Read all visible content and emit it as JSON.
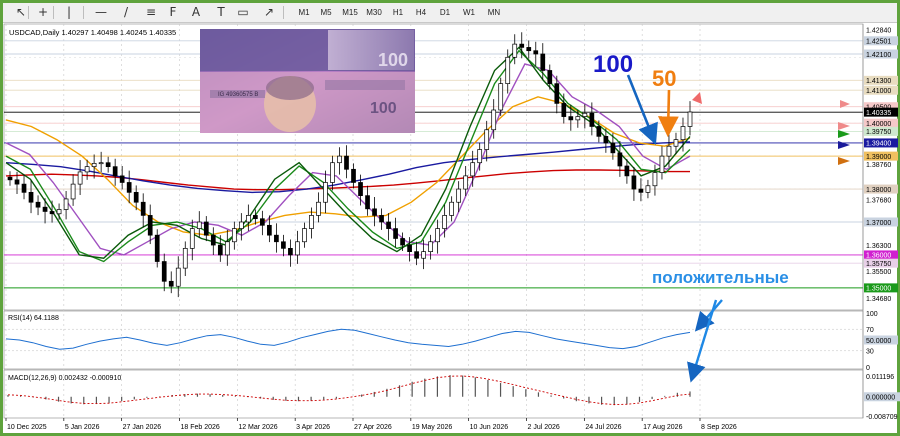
{
  "toolbar": {
    "tools": [
      "cursor-icon",
      "crosshair-icon",
      "vertical-line-icon",
      "horizontal-line-icon",
      "trendline-icon",
      "equidistant-channel-icon",
      "fibonacci-icon",
      "text-icon",
      "label-icon",
      "rectangle-icon",
      "arrow-tool-icon"
    ],
    "timeframes": [
      "M1",
      "M5",
      "M15",
      "M30",
      "H1",
      "H4",
      "D1",
      "W1",
      "MN"
    ]
  },
  "header": {
    "symbol_line": "USDCAD,Daily  1.40297 1.40498 1.40245 1.40335"
  },
  "annotations": {
    "label_100": "100",
    "label_50": "50",
    "label_positive": "положительные"
  },
  "colors": {
    "background": "#ffffff",
    "grid": "#b0b0b0",
    "candle": "#000000",
    "ma_red": "#cc0000",
    "ma_blue": "#1a1aa0",
    "ma_orange": "#f0a000",
    "ma_purple": "#a050c0",
    "ma_green": "#1a8a1a",
    "ma_darkgreen": "#0a5a0a",
    "rsi_line": "#1e6fd0",
    "arrow_blue": "#1565c0",
    "arrow_orange": "#f07e10",
    "frame_green": "#5fa33d"
  },
  "chart_data": [
    {
      "type": "line",
      "title": "USDCAD,Daily",
      "x_labels": [
        "10 Dec 2025",
        "5 Jan 2026",
        "27 Jan 2026",
        "18 Feb 2026",
        "12 Mar 2026",
        "3 Apr 2026",
        "27 Apr 2026",
        "19 May 2026",
        "10 Jun 2026",
        "2 Jul 2026",
        "24 Jul 2026",
        "17 Aug 2026",
        "8 Sep 2026"
      ],
      "y_ticks": [
        "1.42840",
        "1.42501",
        "1.42100",
        "1.41300",
        "1.41000",
        "1.40500",
        "1.40335",
        "1.40000",
        "1.39750",
        "1.39400",
        "1.39000",
        "1.38760",
        "1.38000",
        "1.37680",
        "1.37000",
        "1.36300",
        "1.36000",
        "1.35750",
        "1.35500",
        "1.35000",
        "1.34680"
      ],
      "highlighted_levels": [
        {
          "value": 1.42501,
          "label": "1.42501",
          "color": "#c9d3e0"
        },
        {
          "value": 1.421,
          "label": "1.42100",
          "color": "#c9d3e0"
        },
        {
          "value": 1.413,
          "label": "1.41300",
          "color": "#e8dcc0"
        },
        {
          "value": 1.41,
          "label": "1.41000",
          "color": "#e8dcc0"
        },
        {
          "value": 1.405,
          "label": "1.40500",
          "color": "#f6c9c9"
        },
        {
          "value": 1.40335,
          "label": "1.40335",
          "color": "#000000"
        },
        {
          "value": 1.4,
          "label": "1.40000",
          "color": "#f6c9c9"
        },
        {
          "value": 1.3975,
          "label": "1.39750",
          "color": "#cfe8cf"
        },
        {
          "value": 1.394,
          "label": "1.39400",
          "color": "#1a1aa0"
        },
        {
          "value": 1.39,
          "label": "1.39000",
          "color": "#f0c060"
        },
        {
          "value": 1.38,
          "label": "1.38000",
          "color": "#e0d0c0"
        },
        {
          "value": 1.37,
          "label": "1.37000",
          "color": "#c9d3e0"
        },
        {
          "value": 1.36,
          "label": "1.36000",
          "color": "#d020d0"
        },
        {
          "value": 1.3575,
          "label": "1.35750",
          "color": "#e8d0e8"
        },
        {
          "value": 1.35,
          "label": "1.35000",
          "color": "#1a9a1a"
        }
      ],
      "ylim": [
        1.3445,
        1.4295
      ],
      "close": [
        1.3828,
        1.3815,
        1.379,
        1.376,
        1.3745,
        1.3732,
        1.3725,
        1.3738,
        1.377,
        1.3815,
        1.3852,
        1.3868,
        1.3878,
        1.388,
        1.3868,
        1.384,
        1.382,
        1.379,
        1.376,
        1.372,
        1.366,
        1.358,
        1.352,
        1.3505,
        1.356,
        1.362,
        1.368,
        1.37,
        1.366,
        1.363,
        1.36,
        1.364,
        1.368,
        1.37,
        1.372,
        1.371,
        1.369,
        1.366,
        1.364,
        1.362,
        1.36,
        1.364,
        1.368,
        1.372,
        1.376,
        1.382,
        1.388,
        1.39,
        1.386,
        1.382,
        1.378,
        1.374,
        1.372,
        1.37,
        1.368,
        1.365,
        1.363,
        1.361,
        1.359,
        1.361,
        1.364,
        1.368,
        1.372,
        1.376,
        1.38,
        1.384,
        1.388,
        1.392,
        1.398,
        1.404,
        1.412,
        1.42,
        1.424,
        1.423,
        1.422,
        1.421,
        1.416,
        1.412,
        1.406,
        1.402,
        1.401,
        1.402,
        1.403,
        1.399,
        1.396,
        1.394,
        1.391,
        1.387,
        1.384,
        1.38,
        1.379,
        1.381,
        1.385,
        1.39,
        1.393,
        1.395,
        1.399,
        1.4034
      ],
      "series": [
        {
          "color": "#cc0000",
          "values": [
            1.384,
            1.3843,
            1.3845,
            1.3843,
            1.384,
            1.3835,
            1.3828,
            1.382,
            1.3812,
            1.3806,
            1.38,
            1.3798,
            1.3798,
            1.38,
            1.3802,
            1.3805,
            1.3808,
            1.3812,
            1.3818,
            1.3825,
            1.3833,
            1.384,
            1.3847,
            1.3852,
            1.3856,
            1.3858,
            1.3858,
            1.3857,
            1.3855,
            1.3853,
            1.3853
          ]
        },
        {
          "color": "#1a1aa0",
          "values": [
            1.388,
            1.3875,
            1.3868,
            1.3855,
            1.384,
            1.3825,
            1.3812,
            1.3802,
            1.3795,
            1.379,
            1.3792,
            1.38,
            1.3812,
            1.3828,
            1.3845,
            1.3865,
            1.388,
            1.389,
            1.3898,
            1.3905,
            1.3912,
            1.392,
            1.3928,
            1.3935,
            1.394,
            1.3943
          ]
        },
        {
          "color": "#f0a000",
          "values": [
            1.401,
            1.399,
            1.395,
            1.39,
            1.383,
            1.375,
            1.37,
            1.367,
            1.366,
            1.3675,
            1.37,
            1.372,
            1.373,
            1.3725,
            1.3715,
            1.372,
            1.376,
            1.382,
            1.39,
            1.398,
            1.405,
            1.408,
            1.406,
            1.402,
            1.397,
            1.394,
            1.393,
            1.3955
          ]
        },
        {
          "color": "#a050c0",
          "values": [
            1.394,
            1.3905,
            1.382,
            1.372,
            1.362,
            1.36,
            1.364,
            1.368,
            1.37,
            1.369,
            1.366,
            1.37,
            1.378,
            1.385,
            1.384,
            1.377,
            1.37,
            1.364,
            1.363,
            1.37,
            1.386,
            1.404,
            1.418,
            1.416,
            1.408,
            1.404,
            1.399,
            1.39,
            1.386,
            1.39
          ]
        },
        {
          "color": "#1a8a1a",
          "values": [
            1.39,
            1.386,
            1.374,
            1.361,
            1.358,
            1.364,
            1.369,
            1.37,
            1.368,
            1.364,
            1.37,
            1.38,
            1.387,
            1.382,
            1.374,
            1.367,
            1.362,
            1.364,
            1.376,
            1.394,
            1.412,
            1.422,
            1.415,
            1.406,
            1.401,
            1.395,
            1.386,
            1.385,
            1.392
          ]
        },
        {
          "color": "#0a5a0a",
          "values": [
            1.388,
            1.383,
            1.372,
            1.36,
            1.359,
            1.366,
            1.37,
            1.369,
            1.365,
            1.363,
            1.372,
            1.383,
            1.388,
            1.38,
            1.372,
            1.365,
            1.361,
            1.366,
            1.38,
            1.399,
            1.416,
            1.423,
            1.413,
            1.405,
            1.4,
            1.392,
            1.384,
            1.387,
            1.396
          ]
        }
      ]
    },
    {
      "type": "line",
      "title": "RSI(14) 64.1188",
      "yticks": [
        "100",
        "70",
        "50.0000",
        "30",
        "0"
      ],
      "ylim": [
        0,
        100
      ],
      "values": [
        52,
        50,
        45,
        38,
        33,
        35,
        42,
        48,
        52,
        55,
        50,
        44,
        40,
        45,
        52,
        58,
        60,
        55,
        48,
        42,
        40,
        46,
        54,
        60,
        66,
        70,
        68,
        62,
        56,
        50,
        45,
        42,
        40,
        38,
        42,
        48,
        55,
        62,
        66,
        64,
        58,
        52,
        48,
        44,
        40,
        36,
        34,
        38,
        46,
        54,
        60,
        64
      ]
    },
    {
      "type": "bar",
      "title": "MACD(12,26,9) 0.002432 -0.000910",
      "yticks": [
        "0.011196",
        "0.000000",
        "-0.008709"
      ],
      "ylim": [
        -0.0087,
        0.0112
      ],
      "hist": [
        0.0008,
        0.0005,
        -0.0003,
        -0.0012,
        -0.0022,
        -0.003,
        -0.0034,
        -0.0033,
        -0.0028,
        -0.002,
        -0.0012,
        -0.0005,
        0.0002,
        0.0008,
        0.0012,
        0.0014,
        0.0012,
        0.0008,
        0.0003,
        -0.0002,
        -0.0008,
        -0.0014,
        -0.0018,
        -0.002,
        -0.0018,
        -0.0014,
        -0.0008,
        0.0,
        0.001,
        0.0022,
        0.0036,
        0.0052,
        0.0068,
        0.0082,
        0.0092,
        0.0098,
        0.0096,
        0.0088,
        0.0076,
        0.0062,
        0.0048,
        0.0034,
        0.002,
        0.0006,
        -0.0008,
        -0.002,
        -0.003,
        -0.0036,
        -0.0038,
        -0.0034,
        -0.0024,
        -0.001,
        0.0004,
        0.0018,
        0.0024
      ],
      "signal": [
        0.0009,
        0.0006,
        0.0,
        -0.0008,
        -0.0017,
        -0.0025,
        -0.003,
        -0.0031,
        -0.0029,
        -0.0023,
        -0.0016,
        -0.0009,
        -0.0002,
        0.0004,
        0.0009,
        0.0012,
        0.0012,
        0.001,
        0.0006,
        0.0001,
        -0.0005,
        -0.0011,
        -0.0016,
        -0.0018,
        -0.0018,
        -0.0015,
        -0.001,
        -0.0003,
        0.0006,
        0.0016,
        0.0029,
        0.0044,
        0.006,
        0.0074,
        0.0086,
        0.0093,
        0.0094,
        0.0089,
        0.008,
        0.0068,
        0.0055,
        0.0041,
        0.0028,
        0.0014,
        0.0001,
        -0.0012,
        -0.0023,
        -0.0031,
        -0.0035,
        -0.0034,
        -0.0028,
        -0.0018,
        -0.0006,
        0.0006,
        0.0012
      ]
    }
  ]
}
